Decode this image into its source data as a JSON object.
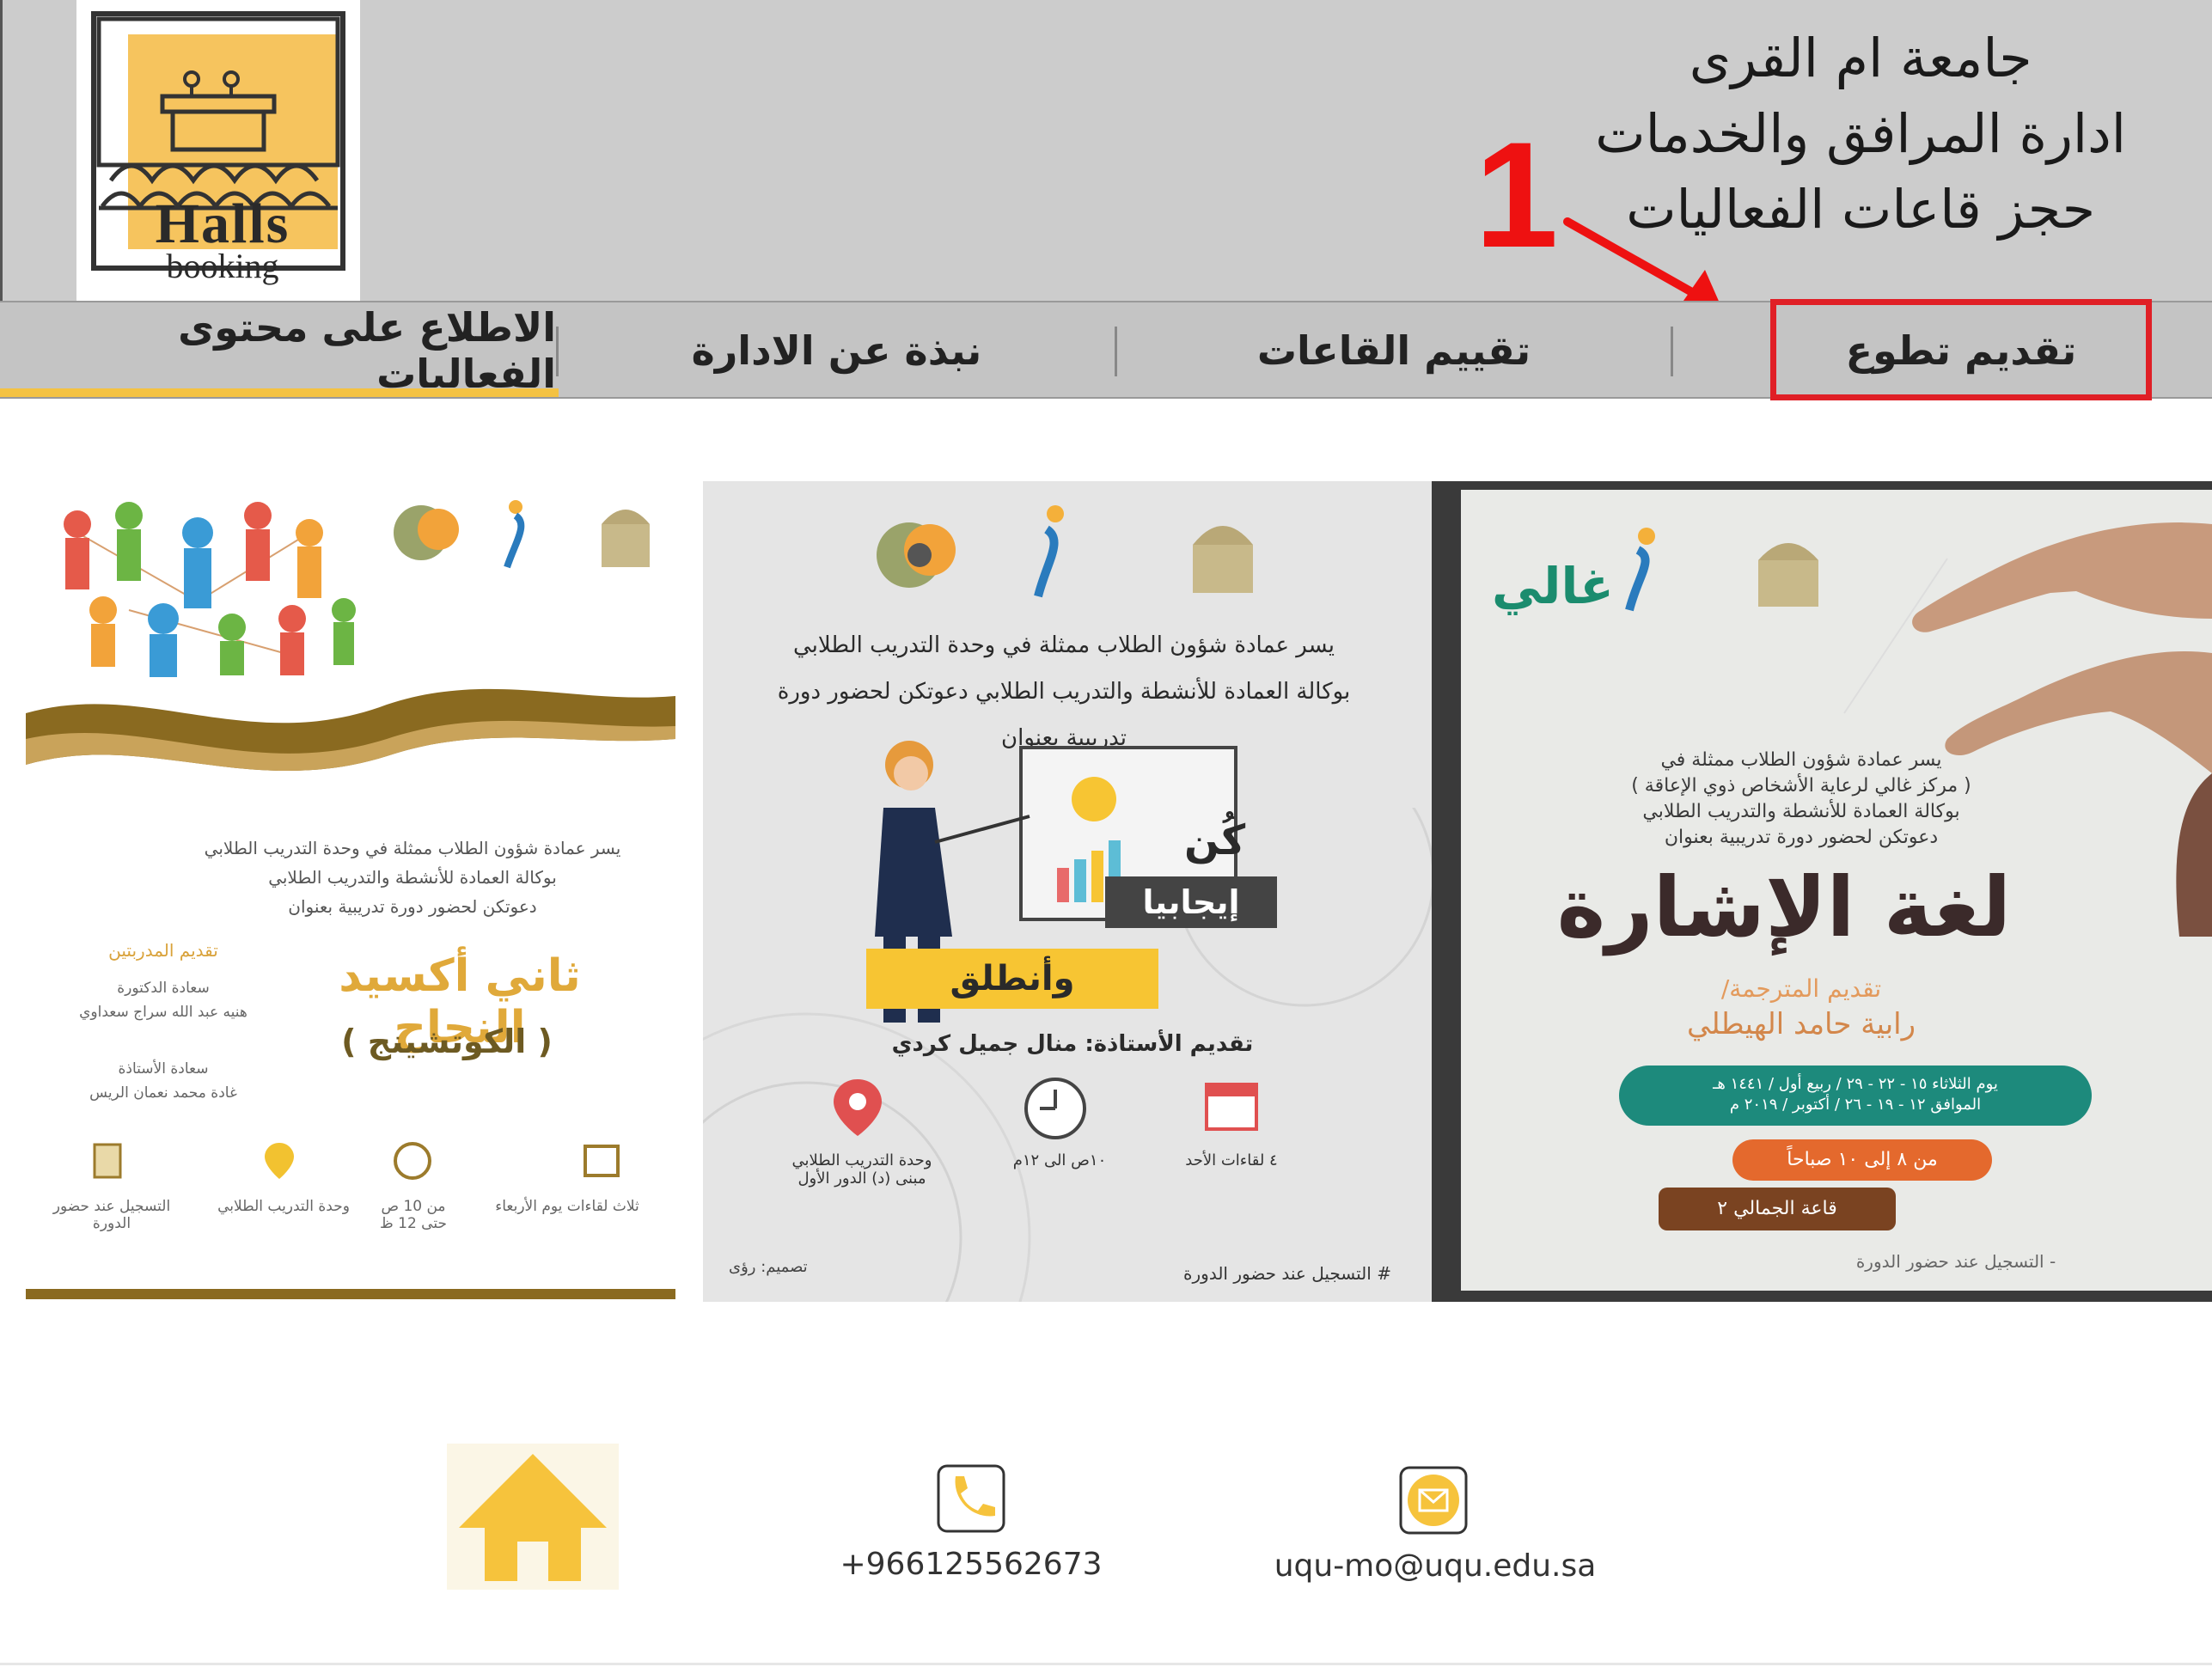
{
  "header": {
    "logo": {
      "title": "Halls",
      "subtitle": "booking",
      "icon": "podium-halls-logo-icon"
    },
    "lines": [
      "جامعة ام القرى",
      "ادارة المرافق والخدمات",
      "حجز قاعات الفعاليات"
    ]
  },
  "annotation": {
    "number": "1",
    "color": "#ee1111"
  },
  "nav": {
    "items": [
      {
        "label": "تقديم تطوع",
        "highlighted": true
      },
      {
        "label": "تقييم القاعات"
      },
      {
        "label": "نبذة عن الادارة"
      },
      {
        "label": "الاطلاع على محتوى الفعاليات",
        "active": true
      }
    ],
    "active_color": "#f4c242",
    "highlight_color": "#e01f26"
  },
  "posters": [
    {
      "intro": [
        "يسر عمادة شؤون الطلاب ممثلة في",
        "( مركز غالي لرعاية الأشخاص ذوي الإعاقة )",
        "بوكالة العمادة للأنشطة والتدريب الطلابي",
        "دعوتكن لحضور دورة تدريبية بعنوان"
      ],
      "title": "لغة الإشارة",
      "presenter_label": "تقديم المترجمة/",
      "presenter": "رابية حامد الهيطلي",
      "date": "يوم الثلاثاء ١٥ - ٢٢ - ٢٩ / ربيع أول / ١٤٤١ هـ",
      "date2": "الموافق ١٢ - ١٩ - ٢٦ / أكتوبر / ٢٠١٩ م",
      "time": "من ٨ إلى ١٠ صباحاً",
      "place": "قاعة الجمالي ٢",
      "note": "- التسجيل عند حضور الدورة",
      "logo": "غالي"
    },
    {
      "intro": [
        "يسر عمادة شؤون الطلاب ممثلة في وحدة التدريب الطلابي",
        "بوكالة العمادة للأنشطة والتدريب الطلابي  دعوتكن لحضور دورة تدريبية بعنوان"
      ],
      "tag1": "كُن",
      "tag2": "إيجابيا",
      "tag3": "وأنطلق",
      "presenter": "تقديم الأستاذة: منال جميل كردي",
      "day": "٤ لقاءات الأحد",
      "time": "١٠ص الى ١٢م",
      "place": "وحدة التدريب الطلابي مبنى (د) الدور الأول",
      "footer_left": "تصميم: رؤى",
      "footer_right": "# التسجيل عند حضور الدورة"
    },
    {
      "intro": [
        "يسر عمادة شؤون الطلاب ممثلة في وحدة التدريب الطلابي",
        "بوكالة العمادة للأنشطة والتدريب الطلابي",
        "دعوتكن لحضور دورة تدريبية بعنوان"
      ],
      "title": "ثاني أكسيد النجاح",
      "subtitle": "( الكوتشينج )",
      "presenters_label": "تقديم المدربتين",
      "presenter1": "سعادة الدكتورة",
      "presenter1_name": "هنيه عبد الله سراج سعداوي",
      "presenter2": "سعادة الأستاذة",
      "presenter2_name": "غادة محمد نعمان الريس",
      "days": "ثلاث لقاءات يوم الأربعاء",
      "time": "من 10 ص حتى 12 ظ",
      "place": "وحدة التدريب الطلابي",
      "note": "التسجيل عند حضور الدورة"
    }
  ],
  "footer": {
    "home_icon": "home-icon",
    "phone": "+966125562673",
    "email": "uqu-mo@uqu.edu.sa",
    "icon_color": "#f6c33c"
  }
}
